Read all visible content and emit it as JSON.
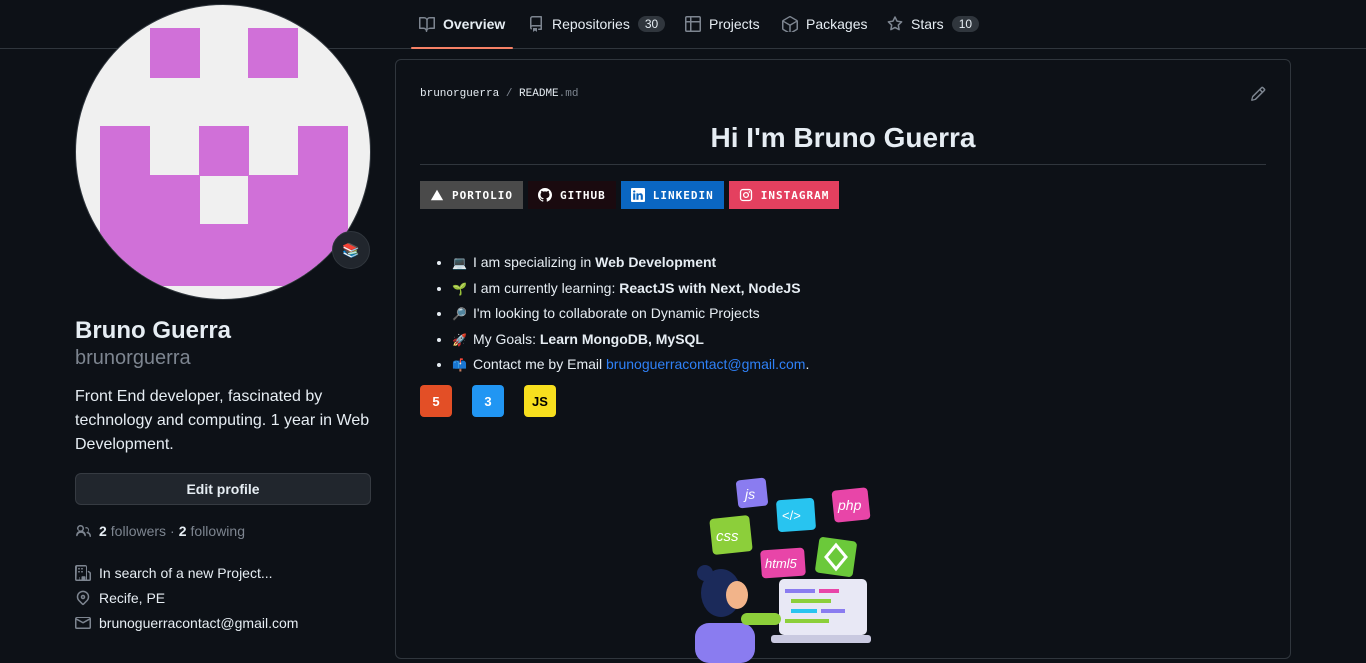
{
  "nav": {
    "tabs": [
      {
        "label": "Overview",
        "icon": "book-icon"
      },
      {
        "label": "Repositories",
        "icon": "repo-icon",
        "count": "30"
      },
      {
        "label": "Projects",
        "icon": "table-icon"
      },
      {
        "label": "Packages",
        "icon": "package-icon"
      },
      {
        "label": "Stars",
        "icon": "star-icon",
        "count": "10"
      }
    ],
    "accent": "#f78166"
  },
  "profile": {
    "name": "Bruno Guerra",
    "login": "brunorguerra",
    "status_emoji": "📚",
    "bio": "Front End developer, fascinated by technology and computing. 1 year in Web Development.",
    "edit_label": "Edit profile",
    "followers_count": "2",
    "followers_label": "followers",
    "dot": "·",
    "following_count": "2",
    "following_label": "following",
    "company": "In search of a new Project...",
    "location": "Recife, PE",
    "email": "brunoguerracontact@gmail.com",
    "avatar_color": "#d070d8"
  },
  "readme": {
    "owner": "brunorguerra",
    "sep": "/",
    "file": "README",
    "ext": ".md",
    "title": "Hi I'm Bruno Guerra",
    "badges": [
      {
        "label": "PORTOLIO",
        "color": "#4a4a4a",
        "icon": "triangle-icon"
      },
      {
        "label": "GITHUB",
        "color": "#1a0a0f",
        "icon": "github-icon"
      },
      {
        "label": "LINKEDIN",
        "color": "#0a66c2",
        "icon": "linkedin-icon"
      },
      {
        "label": "INSTAGRAM",
        "color": "#e4405f",
        "icon": "instagram-icon"
      }
    ],
    "items": [
      {
        "emoji": "💻",
        "text": "I am specializing in ",
        "bold": "Web Development"
      },
      {
        "emoji": "🌱",
        "text": "I am currently learning: ",
        "bold": "ReactJS with Next, NodeJS"
      },
      {
        "emoji": "🔎",
        "text": "I'm looking to collaborate on Dynamic Projects",
        "bold": ""
      },
      {
        "emoji": "🚀",
        "text": "My Goals: ",
        "bold": "Learn MongoDB, MySQL"
      },
      {
        "emoji": "📫",
        "text": "Contact me by Email ",
        "link": "brunoguerracontact@gmail.com",
        "after": "."
      }
    ],
    "tech": [
      {
        "name": "html5-icon",
        "label": "5",
        "color": "#e34f26"
      },
      {
        "name": "css3-icon",
        "label": "3",
        "color": "#1572b6"
      },
      {
        "name": "javascript-icon",
        "label": "JS",
        "color": "#f7df1e"
      }
    ],
    "illustration_labels": [
      "js",
      "css",
      "</>",
      "php",
      "html5"
    ]
  }
}
